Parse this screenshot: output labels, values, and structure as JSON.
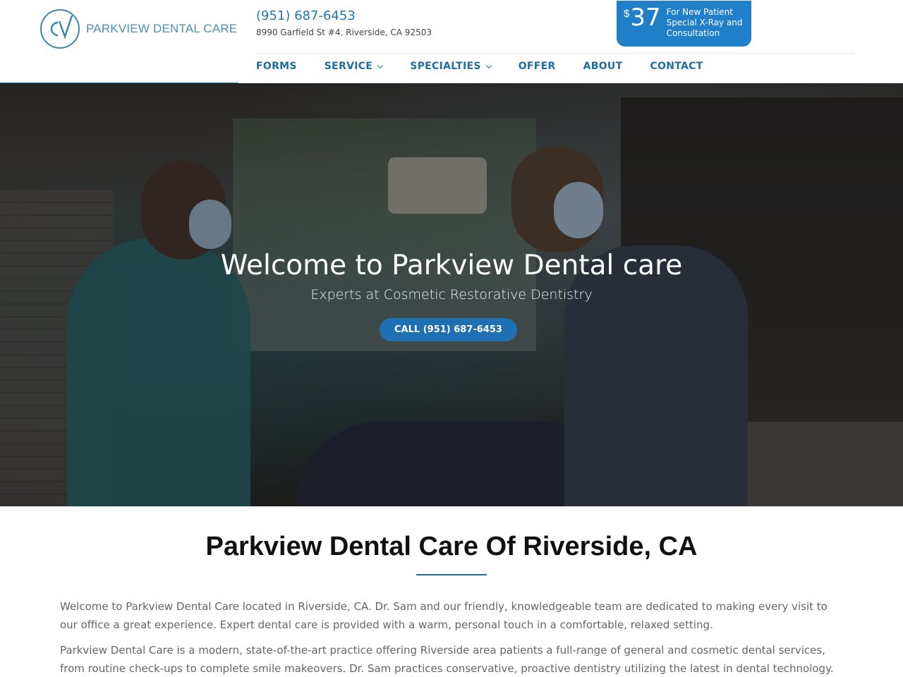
{
  "header": {
    "logo_text": "PARKVIEW DENTAL CARE",
    "phone": "(951) 687-6453",
    "address": "8990 Garfield St #4, Riverside, CA 92503"
  },
  "offer": {
    "currency": "$",
    "amount": "37",
    "line1": "For New Patient",
    "line2": "Special X-Ray and",
    "line3": "Consultation"
  },
  "nav": {
    "items": [
      {
        "label": "FORMS",
        "dropdown": false
      },
      {
        "label": "SERVICE",
        "dropdown": true
      },
      {
        "label": "SPECIALTIES",
        "dropdown": true
      },
      {
        "label": "OFFER",
        "dropdown": false
      },
      {
        "label": "ABOUT",
        "dropdown": false
      },
      {
        "label": "CONTACT",
        "dropdown": false
      }
    ]
  },
  "hero": {
    "title": "Welcome to Parkview Dental care",
    "subtitle": "Experts at Cosmetic Restorative Dentistry",
    "cta_label": "CALL (951) 687-6453"
  },
  "content": {
    "title": "Parkview Dental Care Of Riverside, CA",
    "para1": "Welcome to Parkview Dental Care located in Riverside, CA. Dr. Sam and our friendly, knowledgeable team are dedicated to making every visit to our office a great experience. Expert dental care is provided with a warm, personal touch in a comfortable, relaxed setting.",
    "para2": "Parkview Dental Care is a modern, state-of-the-art practice offering Riverside area patients a full-range of general and cosmetic dental services, from routine check-ups to complete smile makeovers. Dr. Sam practices conservative, proactive dentistry utilizing the latest in dental technology. Your"
  },
  "colors": {
    "brand_blue": "#1f7fc8",
    "nav_blue": "#1f6d9e"
  }
}
